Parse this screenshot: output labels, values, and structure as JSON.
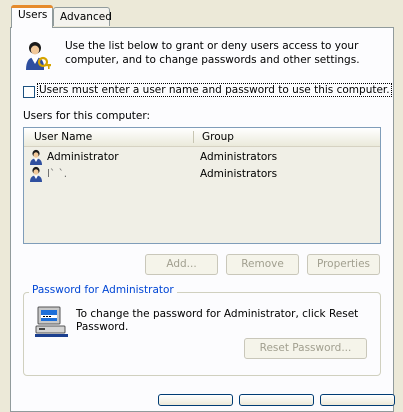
{
  "tabs": [
    {
      "label": "Users",
      "active": true
    },
    {
      "label": "Advanced",
      "active": false
    }
  ],
  "intro": {
    "line1": "Use the list below to grant or deny users access to your",
    "line2": "computer, and to change passwords and other settings.",
    "icon": "users-keys-icon"
  },
  "require_password": {
    "label": "Users must enter a user name and password to use this computer.",
    "checked": false
  },
  "users_list": {
    "label": "Users for this computer:",
    "columns": [
      "User Name",
      "Group"
    ],
    "rows": [
      {
        "name": "Administrator",
        "group": "Administrators",
        "icon": "user-icon"
      },
      {
        "name": "l`  `.",
        "group": "Administrators",
        "icon": "user-icon"
      }
    ]
  },
  "list_buttons": {
    "add": "Add...",
    "remove": "Remove",
    "properties": "Properties"
  },
  "password_group": {
    "title": "Password for Administrator",
    "line1": "To change the password for Administrator, click Reset",
    "line2": "Password.",
    "reset_button": "Reset Password...",
    "icon": "computer-password-icon"
  },
  "colors": {
    "dialog_bg": "#ece9d8",
    "group_title": "#0046d5",
    "tab_highlight": "#e68b2c",
    "disabled_text": "#a19f8f"
  }
}
